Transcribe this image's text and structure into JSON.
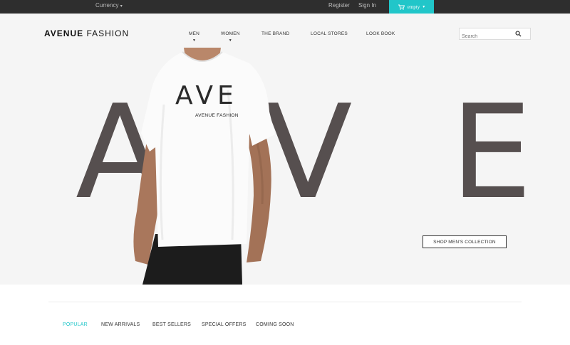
{
  "topbar": {
    "currency_label": "Currency",
    "register_label": "Register",
    "signin_label": "Sign In",
    "cart_label": "empty"
  },
  "header": {
    "logo_bold": "AVENUE",
    "logo_light": "FASHION",
    "nav": [
      "MEN",
      "WOMEN",
      "THE BRAND",
      "LOCAL STORES",
      "LOOK BOOK"
    ],
    "search_placeholder": "Search"
  },
  "hero": {
    "letters": [
      "A",
      "V",
      "E"
    ],
    "shirt_print": "AVE",
    "shirt_brand": "AVENUE FASHION",
    "cta_label": "SHOP MEN'S COLLECTION"
  },
  "tabs": [
    "POPULAR",
    "NEW ARRIVALS",
    "BEST SELLERS",
    "SPECIAL OFFERS",
    "COMING SOON"
  ],
  "colors": {
    "accent": "#21c6c9",
    "topbar": "#2e2e2e",
    "hero_letters": "#564f4f"
  },
  "icons": {
    "cart": "cart-icon",
    "search": "search-icon"
  }
}
